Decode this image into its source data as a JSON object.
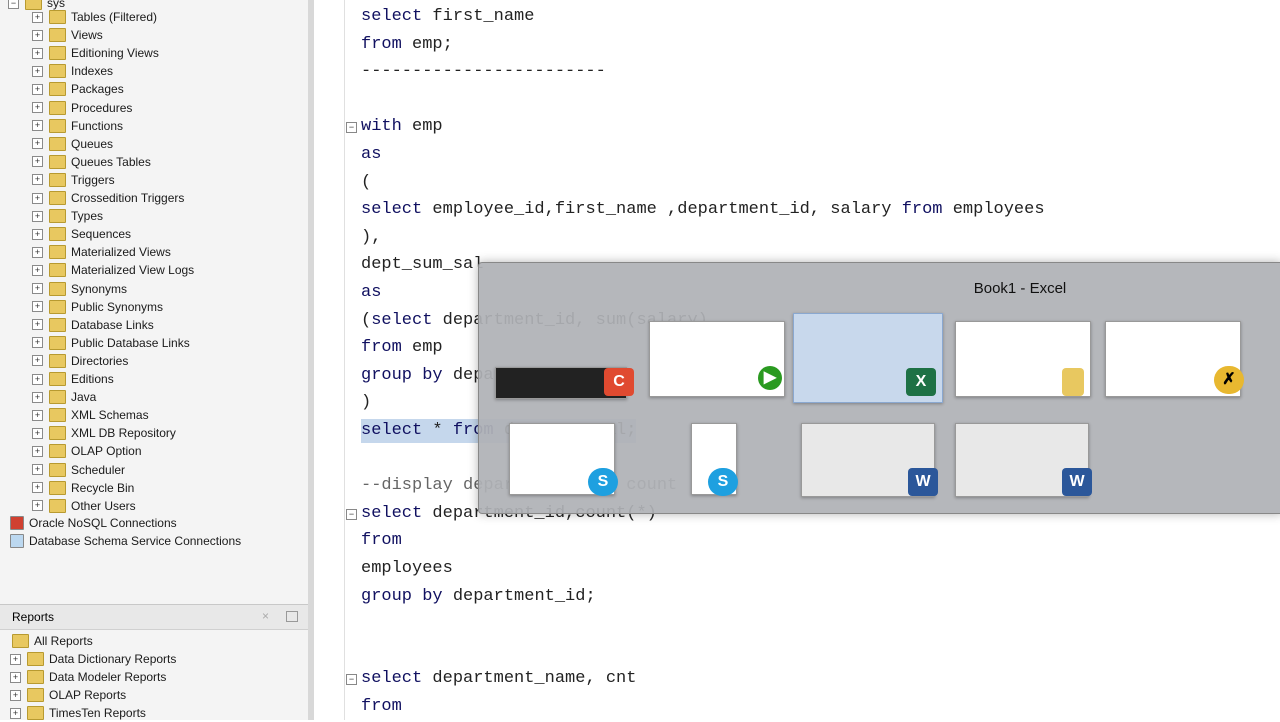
{
  "navigator": {
    "root": "sys",
    "items": [
      "Tables (Filtered)",
      "Views",
      "Editioning Views",
      "Indexes",
      "Packages",
      "Procedures",
      "Functions",
      "Queues",
      "Queues Tables",
      "Triggers",
      "Crossedition Triggers",
      "Types",
      "Sequences",
      "Materialized Views",
      "Materialized View Logs",
      "Synonyms",
      "Public Synonyms",
      "Database Links",
      "Public Database Links",
      "Directories",
      "Editions",
      "Java",
      "XML Schemas",
      "XML DB Repository",
      "OLAP Option",
      "Scheduler",
      "Recycle Bin",
      "Other Users"
    ],
    "connections": [
      "Oracle NoSQL Connections",
      "Database Schema Service Connections"
    ]
  },
  "reports": {
    "title": "Reports",
    "items": [
      "All Reports",
      "Data Dictionary Reports",
      "Data Modeler Reports",
      "OLAP Reports",
      "TimesTen Reports"
    ]
  },
  "editor": {
    "lines": [
      {
        "t": "select first_name"
      },
      {
        "t": "from emp;"
      },
      {
        "t": "------------------------"
      },
      {
        "t": ""
      },
      {
        "t": "with emp",
        "fold": true
      },
      {
        "t": "as"
      },
      {
        "t": "("
      },
      {
        "t": "select employee_id,first_name ,department_id, salary from employees"
      },
      {
        "t": "),"
      },
      {
        "t": "dept_sum_sal"
      },
      {
        "t": "as"
      },
      {
        "t": "(select department_id, sum(salary)"
      },
      {
        "t": "from emp"
      },
      {
        "t": "group by department_id"
      },
      {
        "t": ")"
      },
      {
        "t": "select * from dept_sum_sal;",
        "sel": true
      },
      {
        "t": ""
      },
      {
        "t": "--display department wise count",
        "cm": true
      },
      {
        "t": "select department_id,count(*)",
        "fold": true
      },
      {
        "t": "from"
      },
      {
        "t": "employees"
      },
      {
        "t": "group by department_id;"
      },
      {
        "t": ""
      },
      {
        "t": ""
      },
      {
        "t": "select department_name, cnt",
        "fold": true
      },
      {
        "t": "from"
      }
    ]
  },
  "task_switcher": {
    "title": "Book1 - Excel",
    "windows": [
      "Camtasia",
      "SQL Developer",
      "Excel",
      "File Explorer",
      "Unknown App",
      "Skype",
      "Skype",
      "Word",
      "Word"
    ]
  }
}
